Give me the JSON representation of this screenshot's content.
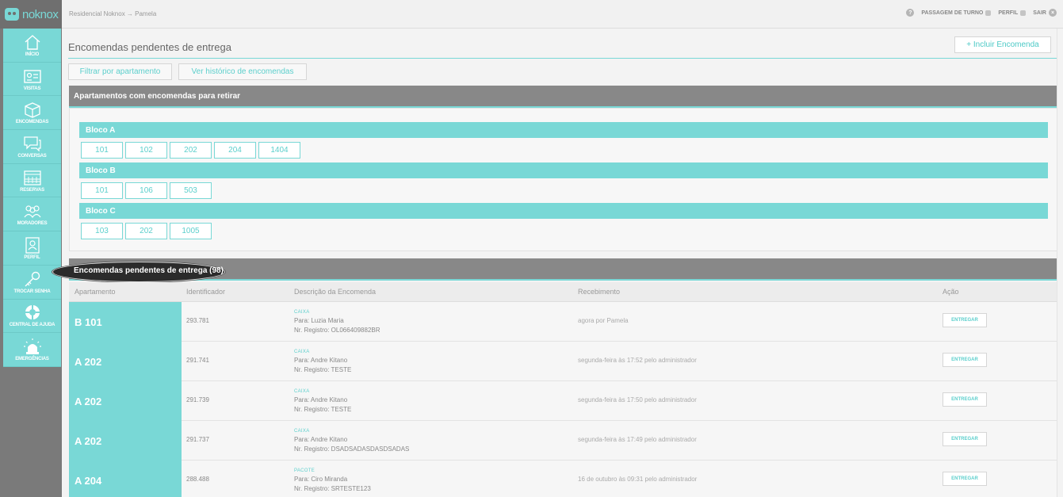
{
  "topbar": {
    "logo_text": "noknox",
    "breadcrumb": "Residencial Noknox → Pamela",
    "help_icon": "?",
    "shift_label": "PASSAGEM DE TURNO",
    "profile_label": "PERFIL",
    "logout_label": "SAIR"
  },
  "sidebar": {
    "items": [
      {
        "label": "INÍCIO",
        "icon": "home-icon"
      },
      {
        "label": "VISITAS",
        "icon": "id-card-icon"
      },
      {
        "label": "ENCOMENDAS",
        "icon": "package-icon"
      },
      {
        "label": "CONVERSAS",
        "icon": "chat-icon"
      },
      {
        "label": "RESERVAS",
        "icon": "calendar-icon"
      },
      {
        "label": "MORADORES",
        "icon": "people-icon"
      },
      {
        "label": "PERFIL",
        "icon": "profile-icon"
      },
      {
        "label": "TROCAR SENHA",
        "icon": "key-icon"
      },
      {
        "label": "CENTRAL DE AJUDA",
        "icon": "lifebuoy-icon"
      },
      {
        "label": "EMERGÊNCIAS",
        "icon": "alarm-icon"
      }
    ]
  },
  "main": {
    "title": "Encomendas pendentes de entrega",
    "add_button": "+ Incluir Encomenda",
    "filter_button": "Filtrar por apartamento",
    "history_button": "Ver histórico de encomendas",
    "apartments_panel_title": "Apartamentos com encomendas para retirar",
    "blocks": [
      {
        "name": "Bloco A",
        "apartments": [
          "101",
          "102",
          "202",
          "204",
          "1404"
        ]
      },
      {
        "name": "Bloco B",
        "apartments": [
          "101",
          "106",
          "503"
        ]
      },
      {
        "name": "Bloco C",
        "apartments": [
          "103",
          "202",
          "1005"
        ]
      }
    ],
    "pending_panel_title": "Encomendas pendentes de entrega (98)",
    "columns": [
      "Apartamento",
      "Identificador",
      "Descrição da Encomenda",
      "Recebimento",
      "Ação"
    ],
    "rows": [
      {
        "apt": "B 101",
        "id": "293.781",
        "type": "CAIXA",
        "to": "Para: Luzia Maria",
        "reg": "Nr. Registro: OL066409882BR",
        "received": "agora por Pamela",
        "action": "ENTREGAR"
      },
      {
        "apt": "A 202",
        "id": "291.741",
        "type": "CAIXA",
        "to": "Para: Andre Kitano",
        "reg": "Nr. Registro: TESTE",
        "received": "segunda-feira às 17:52 pelo administrador",
        "action": "ENTREGAR"
      },
      {
        "apt": "A 202",
        "id": "291.739",
        "type": "CAIXA",
        "to": "Para: Andre Kitano",
        "reg": "Nr. Registro: TESTE",
        "received": "segunda-feira às 17:50 pelo administrador",
        "action": "ENTREGAR"
      },
      {
        "apt": "A 202",
        "id": "291.737",
        "type": "CAIXA",
        "to": "Para: Andre Kitano",
        "reg": "Nr. Registro: DSADSADASDASDSADAS",
        "received": "segunda-feira às 17:49 pelo administrador",
        "action": "ENTREGAR"
      },
      {
        "apt": "A 204",
        "id": "288.488",
        "type": "PACOTE",
        "to": "Para: Ciro Miranda",
        "reg": "Nr. Registro: SRTESTE123",
        "received": "16 de outubro às 09:31 pelo administrador",
        "action": "ENTREGAR"
      }
    ]
  },
  "colors": {
    "accent": "#79d8d6",
    "sidebar_bg": "#7a7a7a",
    "panel_header": "#888888"
  }
}
